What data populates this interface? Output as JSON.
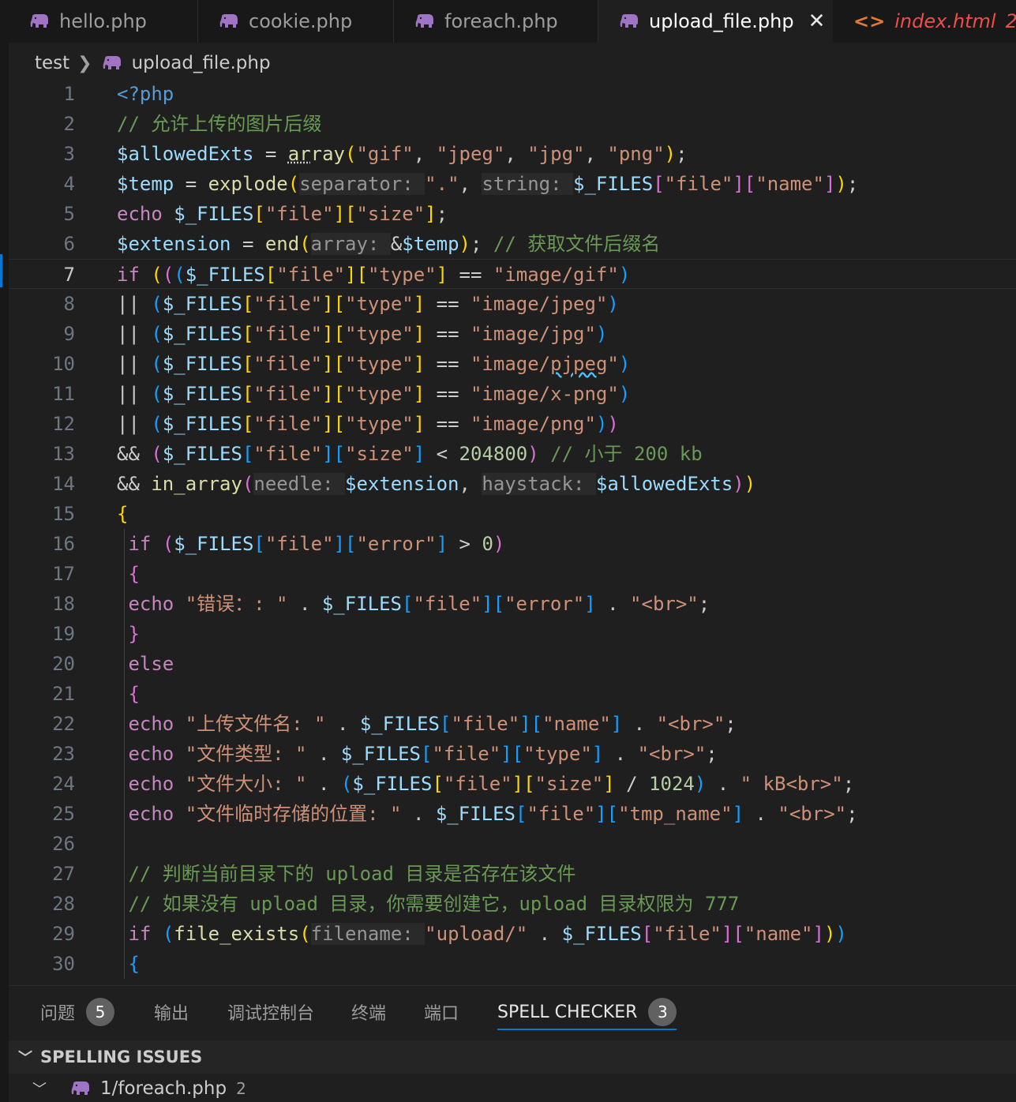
{
  "tabs": [
    {
      "label": "hello.php",
      "icon": "php-elephant-icon"
    },
    {
      "label": "cookie.php",
      "icon": "php-elephant-icon"
    },
    {
      "label": "foreach.php",
      "icon": "php-elephant-icon"
    },
    {
      "label": "upload_file.php",
      "icon": "php-elephant-icon",
      "active": true,
      "close": "✕"
    },
    {
      "label": "index.html",
      "icon": "html-brackets-icon",
      "problems": "2"
    }
  ],
  "breadcrumb": {
    "folder": "test",
    "file": "upload_file.php"
  },
  "editor": {
    "current_line": 7,
    "line_numbers": [
      "1",
      "2",
      "3",
      "4",
      "5",
      "6",
      "7",
      "8",
      "9",
      "10",
      "11",
      "12",
      "13",
      "14",
      "15",
      "16",
      "17",
      "18",
      "19",
      "20",
      "21",
      "22",
      "23",
      "24",
      "25",
      "26",
      "27",
      "28",
      "29",
      "30"
    ],
    "code_lines": [
      "<?php",
      "// 允许上传的图片后缀",
      "$allowedExts = array(\"gif\", \"jpeg\", \"jpg\", \"png\");",
      "$temp = explode(separator: \".\", string: $_FILES[\"file\"][\"name\"]);",
      "echo $_FILES[\"file\"][\"size\"];",
      "$extension = end(array: &$temp); // 获取文件后缀名",
      "if ((($_FILES[\"file\"][\"type\"] == \"image/gif\")",
      "|| ($_FILES[\"file\"][\"type\"] == \"image/jpeg\")",
      "|| ($_FILES[\"file\"][\"type\"] == \"image/jpg\")",
      "|| ($_FILES[\"file\"][\"type\"] == \"image/pjpeg\")",
      "|| ($_FILES[\"file\"][\"type\"] == \"image/x-png\")",
      "|| ($_FILES[\"file\"][\"type\"] == \"image/png\"))",
      "&& ($_FILES[\"file\"][\"size\"] < 204800) // 小于 200 kb",
      "&& in_array(needle: $extension, haystack: $allowedExts))",
      "{",
      " if ($_FILES[\"file\"][\"error\"] > 0)",
      " {",
      " echo \"错误：: \" . $_FILES[\"file\"][\"error\"] . \"<br>\";",
      " }",
      " else",
      " {",
      " echo \"上传文件名: \" . $_FILES[\"file\"][\"name\"] . \"<br>\";",
      " echo \"文件类型: \" . $_FILES[\"file\"][\"type\"] . \"<br>\";",
      " echo \"文件大小: \" . ($_FILES[\"file\"][\"size\"] / 1024) . \" kB<br>\";",
      " echo \"文件临时存储的位置: \" . $_FILES[\"file\"][\"tmp_name\"] . \"<br>\";",
      "",
      " // 判断当前目录下的 upload 目录是否存在该文件",
      " // 如果没有 upload 目录，你需要创建它，upload 目录权限为 777",
      " if (file_exists(filename: \"upload/\" . $_FILES[\"file\"][\"name\"]))",
      " {"
    ]
  },
  "panel": {
    "tabs": [
      {
        "label": "问题",
        "badge": "5"
      },
      {
        "label": "输出"
      },
      {
        "label": "调试控制台"
      },
      {
        "label": "终端"
      },
      {
        "label": "端口"
      },
      {
        "label": "SPELL CHECKER",
        "badge": "3",
        "active": true
      }
    ],
    "section_title": "SPELLING ISSUES",
    "issues": [
      {
        "file": "1/foreach.php",
        "count": "2"
      }
    ]
  },
  "colors": {
    "accent": "#0078d4",
    "keyword": "#c586c0",
    "variable": "#9cdcfe",
    "string": "#ce9178",
    "comment": "#6a9955",
    "function": "#dcdcaa",
    "error": "#f14c4c"
  }
}
